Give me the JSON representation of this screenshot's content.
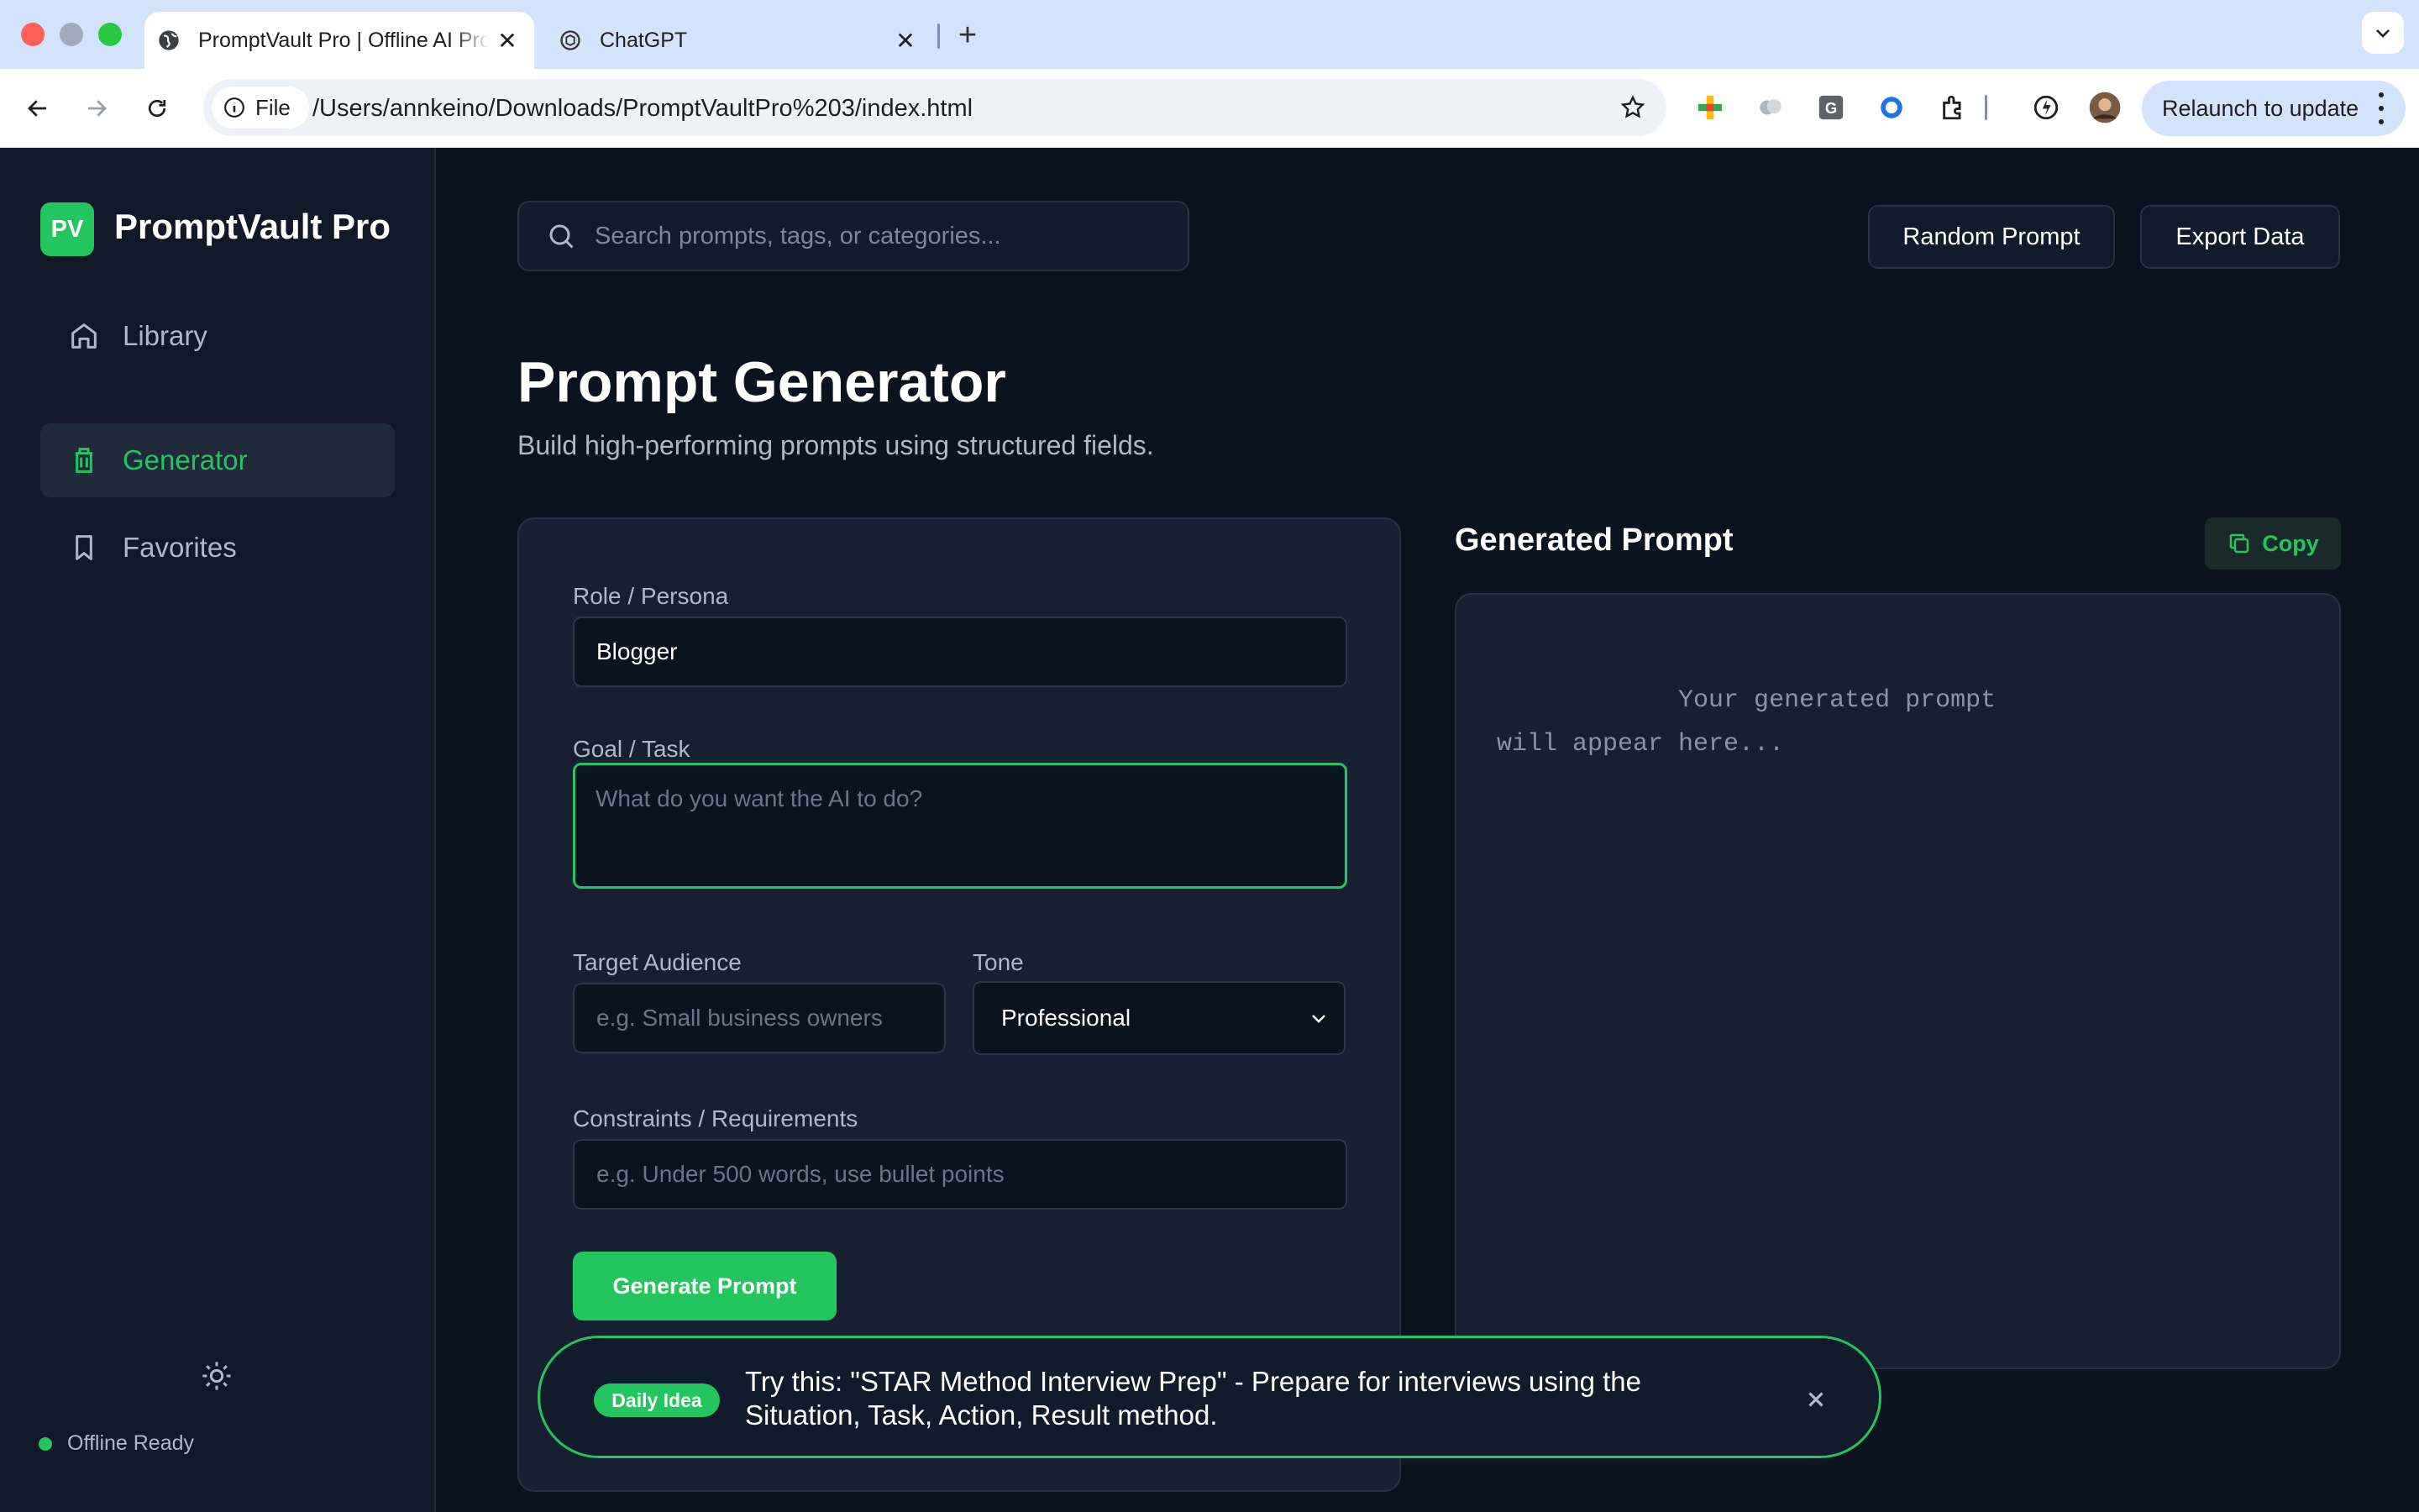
{
  "browser": {
    "tabs": [
      {
        "title": "PromptVault Pro | Offline AI Prompt Library",
        "active": true
      },
      {
        "title": "ChatGPT",
        "active": false
      }
    ],
    "site_chip": "File",
    "url": "/Users/annkeino/Downloads/PromptVaultPro%203/index.html",
    "relaunch_label": "Relaunch to update"
  },
  "app": {
    "logo_initials": "PV",
    "brand": "PromptVault Pro",
    "nav": [
      {
        "label": "Library",
        "icon": "home-icon",
        "active": false
      },
      {
        "label": "Generator",
        "icon": "trash-icon",
        "active": true
      },
      {
        "label": "Favorites",
        "icon": "bookmark-icon",
        "active": false
      }
    ],
    "status": "Offline Ready",
    "accent": "#22c55e"
  },
  "header": {
    "search_placeholder": "Search prompts, tags, or categories...",
    "random_label": "Random Prompt",
    "export_label": "Export Data"
  },
  "page": {
    "title": "Prompt Generator",
    "subtitle": "Build high-performing prompts using structured fields."
  },
  "form": {
    "role_label": "Role / Persona",
    "role_value": "Blogger",
    "goal_label": "Goal / Task",
    "goal_placeholder": "What do you want the AI to do?",
    "audience_label": "Target Audience",
    "audience_placeholder": "e.g. Small business owners",
    "tone_label": "Tone",
    "tone_value": "Professional",
    "constraints_label": "Constraints / Requirements",
    "constraints_placeholder": "e.g. Under 500 words, use bullet points",
    "generate_label": "Generate Prompt"
  },
  "output": {
    "title": "Generated Prompt",
    "copy_label": "Copy",
    "placeholder": "            Your generated prompt\nwill appear here..."
  },
  "toast": {
    "badge": "Daily Idea",
    "text": "Try this: \"STAR Method Interview Prep\" - Prepare for interviews using the Situation, Task, Action, Result method."
  }
}
